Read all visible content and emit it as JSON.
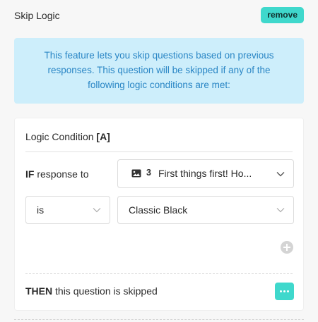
{
  "header": {
    "title": "Skip Logic",
    "remove_label": "remove"
  },
  "info": {
    "text": "This feature lets you skip questions based on previous responses. This question will be skipped if any of the following logic conditions are met:"
  },
  "condition": {
    "title_prefix": "Logic Condition ",
    "title_tag": "[A]",
    "if_keyword": "IF",
    "if_text": " response to",
    "question": {
      "icon": "image-icon",
      "number": "3",
      "text": "First things first! Ho..."
    },
    "operator": "is",
    "value": "Classic Black",
    "then_keyword": "THEN",
    "then_text": " this question is skipped"
  },
  "colors": {
    "accent": "#3fd8cc",
    "info_bg": "#cdeefb",
    "info_text": "#2a86c5"
  }
}
